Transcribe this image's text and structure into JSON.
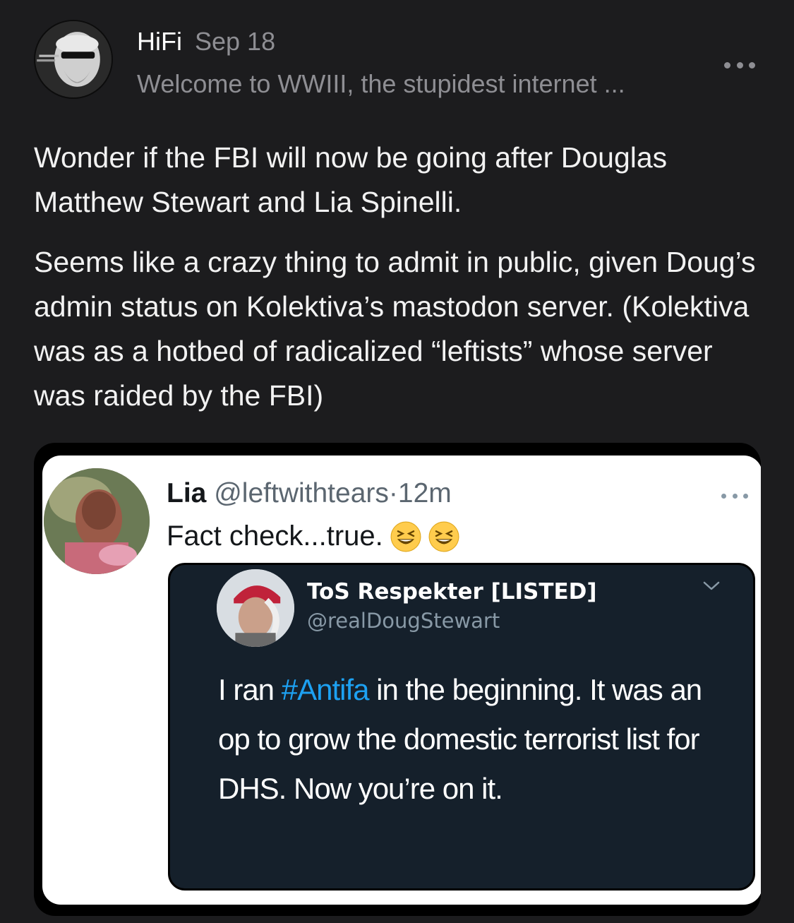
{
  "post": {
    "author": "HiFi",
    "date": "Sep 18",
    "publication": "Welcome to WWIII, the stupidest internet ...",
    "paragraphs": [
      "Wonder if the FBI will now be going after Douglas Matthew Stewart and Lia Spinelli.",
      "Seems like a crazy thing to admit in public, given Doug’s admin status on Kolektiva’s mastodon server. (Kolektiva was as a hotbed of radicalized “leftists” whose server was raided by the FBI)"
    ],
    "more_icon": "ellipsis-icon"
  },
  "embed": {
    "tweet": {
      "name": "Lia",
      "handle": "@leftwithtears",
      "separator": "·",
      "time": "12m",
      "text": "Fact check...true.",
      "emoji": "laughing-face-icon"
    },
    "quoted": {
      "name": "ToS Respekter [LISTED]",
      "handle": "@realDougStewart",
      "text_before": "I ran ",
      "hashtag": "#Antifa",
      "text_after": " in the beginning. It was an op to grow the domestic terrorist list for DHS. Now you’re on it."
    }
  },
  "colors": {
    "background": "#1c1c1e",
    "secondary_text": "#8e8e93",
    "quoted_bg": "#15202b",
    "hashtag": "#1da1f2"
  }
}
